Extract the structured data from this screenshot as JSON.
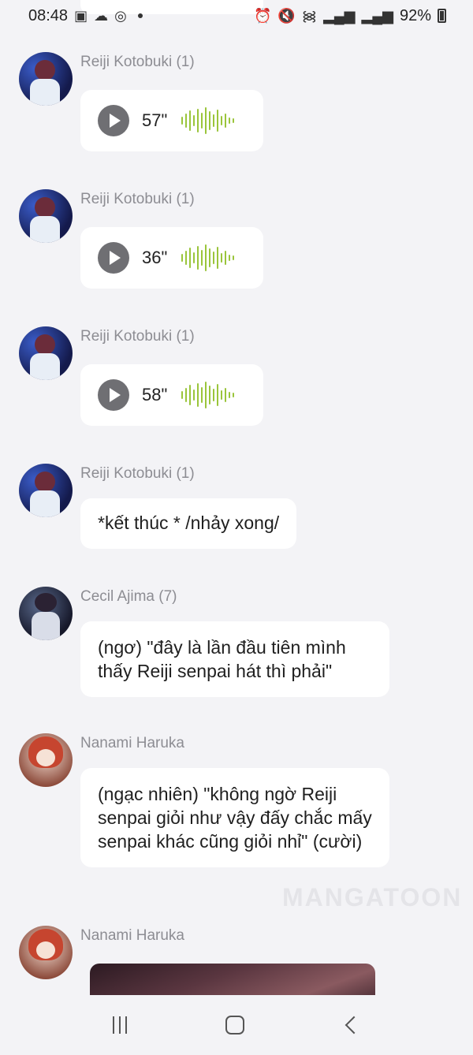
{
  "status_bar": {
    "time": "08:48",
    "battery_percent": "92%",
    "left_icons": [
      "gallery-icon",
      "cloud-icon",
      "instagram-icon",
      "notification-dot-icon"
    ],
    "right_icons": [
      "alarm-icon",
      "mute-icon",
      "wifi-icon",
      "signal-icon",
      "signal-icon",
      "battery-icon"
    ]
  },
  "messages": [
    {
      "sender": "Reiji Kotobuki (1)",
      "type": "voice",
      "duration": "57\""
    },
    {
      "sender": "Reiji Kotobuki (1)",
      "type": "voice",
      "duration": "36\""
    },
    {
      "sender": "Reiji Kotobuki (1)",
      "type": "voice",
      "duration": "58\""
    },
    {
      "sender": "Reiji Kotobuki (1)",
      "type": "text",
      "text": "*kết thúc * /nhảy xong/"
    },
    {
      "sender": "Cecil Ajima (7)",
      "type": "text",
      "text": "(ngơ) \"đây là lần đầu tiên mình thấy Reiji senpai hát thì phải\""
    },
    {
      "sender": "Nanami Haruka",
      "type": "text",
      "text": "(ngạc nhiên) \"không ngờ Reiji senpai giỏi như vậy đấy chắc mấy senpai khác cũng giỏi nhỉ\" (cười)"
    },
    {
      "sender": "Nanami Haruka",
      "type": "image"
    }
  ],
  "watermark": "MANGATOON",
  "nav_bar": {
    "icons": [
      "recents-icon",
      "home-icon",
      "back-icon"
    ]
  },
  "colors": {
    "background": "#f3f3f6",
    "bubble": "#ffffff",
    "waveform": "#9ac53b",
    "sender_name": "#8d8d93"
  }
}
